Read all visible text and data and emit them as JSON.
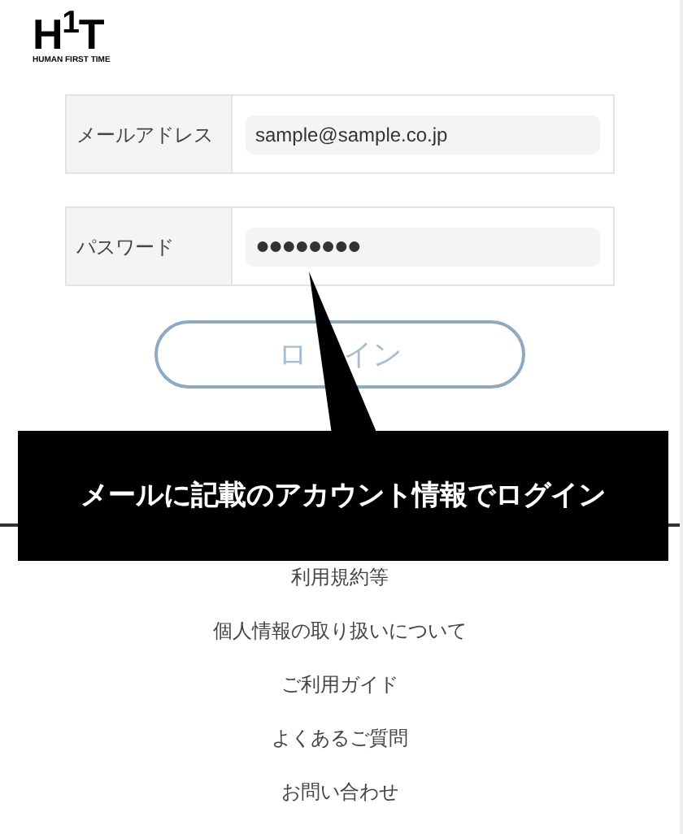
{
  "logo": {
    "mark": "H$^{1}$T",
    "tagline": "HUMAN FIRST TIME"
  },
  "form": {
    "fields": [
      {
        "label": "メールアドレス",
        "value": "sample@sample.co.jp",
        "kind": "text"
      },
      {
        "label": "パスワード",
        "value": "●●●●●●●●",
        "kind": "password"
      }
    ],
    "submit_visible_parts": [
      "ロ",
      "イン"
    ]
  },
  "callout": {
    "text": "メールに記載のアカウント情報でログイン"
  },
  "footer_links": [
    "利用規約等",
    "個人情報の取り扱いについて",
    "ご利用ガイド",
    "よくあるご質問",
    "お問い合わせ"
  ]
}
